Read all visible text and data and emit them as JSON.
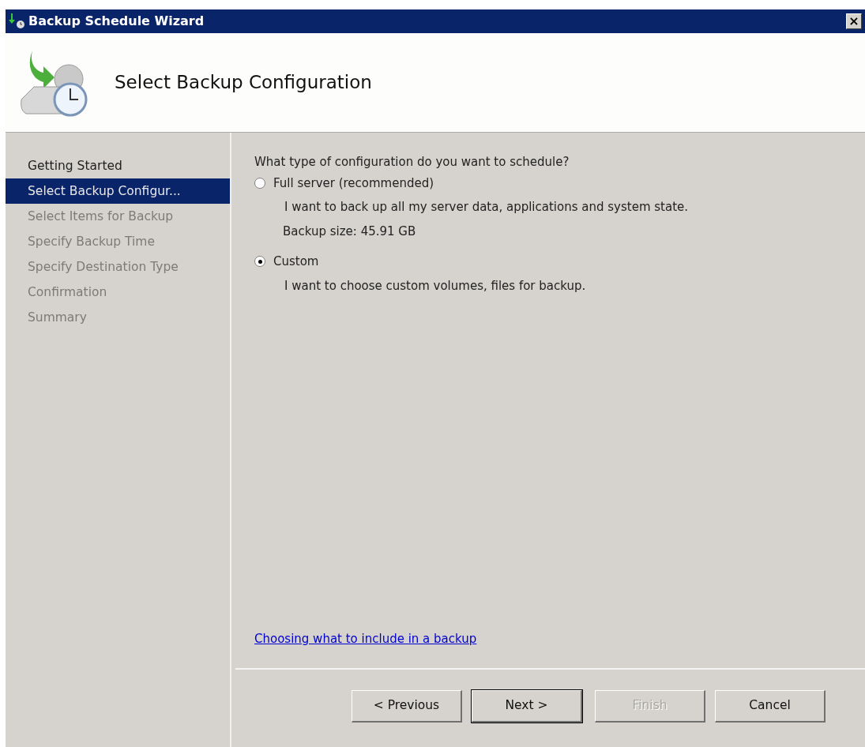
{
  "window": {
    "title": "Backup Schedule Wizard",
    "close": "×"
  },
  "header": {
    "title": "Select Backup Configuration"
  },
  "sidebar": {
    "items": [
      {
        "label": "Getting Started",
        "selected": false,
        "disabled": false
      },
      {
        "label": "Select Backup Configur...",
        "selected": true,
        "disabled": false
      },
      {
        "label": "Select Items for Backup",
        "selected": false,
        "disabled": true
      },
      {
        "label": "Specify Backup Time",
        "selected": false,
        "disabled": true
      },
      {
        "label": "Specify Destination Type",
        "selected": false,
        "disabled": true
      },
      {
        "label": "Confirmation",
        "selected": false,
        "disabled": true
      },
      {
        "label": "Summary",
        "selected": false,
        "disabled": true
      }
    ]
  },
  "question": "What type of configuration do you want to schedule?",
  "options": [
    {
      "label": "Full server (recommended)",
      "selected": false,
      "details": [
        "I want to back up all my server data, applications and system state.",
        "Backup size: 45.91 GB"
      ]
    },
    {
      "label": "Custom",
      "selected": true,
      "details": [
        "I want to choose custom volumes, files for backup."
      ]
    }
  ],
  "help_link": "Choosing what to include in a backup",
  "buttons": [
    {
      "label": "< Previous",
      "disabled": false,
      "default": false
    },
    {
      "label": "Next >",
      "disabled": false,
      "default": true
    },
    {
      "label": "Finish",
      "disabled": true,
      "default": false
    },
    {
      "label": "Cancel",
      "disabled": false,
      "default": false
    }
  ]
}
